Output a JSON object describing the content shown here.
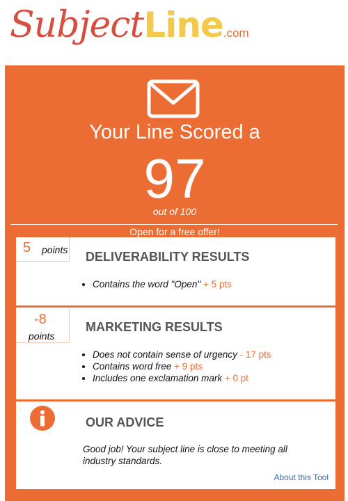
{
  "logo": {
    "subject": "Subject",
    "line": "Line",
    "domain": ".com"
  },
  "score_panel": {
    "headline": "Your Line Scored a",
    "score": "97",
    "out_of": "out of 100",
    "subject_line": "Open for a free offer!"
  },
  "deliverability": {
    "points": "5",
    "points_label": "points",
    "title": "DELIVERABILITY RESULTS",
    "items": [
      {
        "text": "Contains the word \"Open\"",
        "delta": "+ 5 pts"
      }
    ]
  },
  "marketing": {
    "points": "-8",
    "points_label": "points",
    "title": "MARKETING RESULTS",
    "items": [
      {
        "text": "Does not contain sense of urgency",
        "delta": "- 17 pts"
      },
      {
        "text": "Contains word free",
        "delta": "+ 9 pts"
      },
      {
        "text": "Includes one exclamation mark",
        "delta": "+ 0 pt"
      }
    ]
  },
  "advice": {
    "icon": "info-icon",
    "title": "OUR ADVICE",
    "text": "Good job! Your subject line is close to meeting all industry standards.",
    "link": "About this Tool"
  },
  "colors": {
    "accent": "#ec6d34",
    "logo_red": "#d94d3f",
    "logo_yellow": "#f2c94c",
    "link": "#3a6ea8"
  }
}
